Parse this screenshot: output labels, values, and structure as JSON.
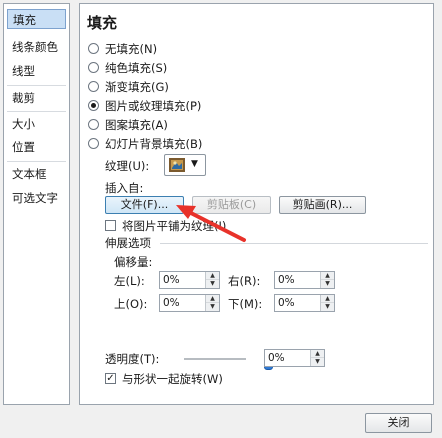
{
  "sidebar": {
    "items": [
      {
        "label": "填充"
      },
      {
        "label": "线条颜色"
      },
      {
        "label": "线型"
      },
      {
        "label": "裁剪"
      },
      {
        "label": "大小"
      },
      {
        "label": "位置"
      },
      {
        "label": "文本框"
      },
      {
        "label": "可选文字"
      }
    ]
  },
  "main": {
    "title": "填充",
    "fill_options": [
      {
        "label": "无填充(N)",
        "selected": false
      },
      {
        "label": "纯色填充(S)",
        "selected": false
      },
      {
        "label": "渐变填充(G)",
        "selected": false
      },
      {
        "label": "图片或纹理填充(P)",
        "selected": true
      },
      {
        "label": "图案填充(A)",
        "selected": false
      },
      {
        "label": "幻灯片背景填充(B)",
        "selected": false
      }
    ],
    "texture_label": "纹理(U):",
    "insert_from_label": "插入自:",
    "file_button": "文件(F)...",
    "clipboard_button": "剪贴板(C)",
    "clipart_button": "剪贴画(R)...",
    "tile_checkbox": {
      "label": "将图片平铺为纹理(I)",
      "checked": false
    },
    "stretch_group": "伸展选项",
    "offsets_label": "偏移量:",
    "offsets": {
      "left": {
        "label": "左(L):",
        "value": "0%"
      },
      "right": {
        "label": "右(R):",
        "value": "0%"
      },
      "top": {
        "label": "上(O):",
        "value": "0%"
      },
      "bottom": {
        "label": "下(M):",
        "value": "0%"
      }
    },
    "transparency": {
      "label": "透明度(T):",
      "value": "0%",
      "level": 0
    },
    "rotate_checkbox": {
      "label": "与形状一起旋转(W)",
      "checked": true
    }
  },
  "footer": {
    "close_button": "关闭"
  },
  "icons": {
    "spin_up": "▲",
    "spin_down": "▼",
    "dropdown": "▼",
    "check": "✓"
  },
  "colors": {
    "accent": "#2f7ad6",
    "selection": "#c9dff5",
    "annotation_arrow": "#e8322a"
  }
}
